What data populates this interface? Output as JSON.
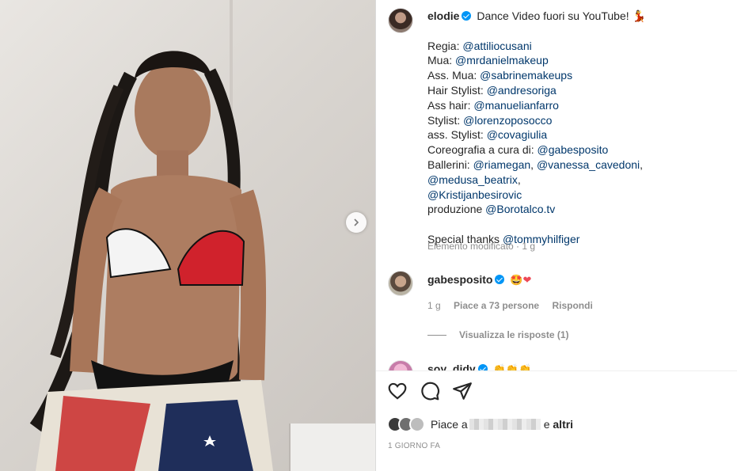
{
  "post": {
    "username": "elodie",
    "title": "Dance Video fuori su YouTube! 💃",
    "credits": [
      {
        "label": "Regia: ",
        "handle": "@attiliocusani"
      },
      {
        "label": "Mua: ",
        "handle": "@mrdanielmakeup"
      },
      {
        "label": "Ass. Mua: ",
        "handle": "@sabrinemakeups"
      },
      {
        "label": "Hair Stylist: ",
        "handle": "@andresoriga"
      },
      {
        "label": "Ass hair: ",
        "handle": "@manuelianfarro"
      },
      {
        "label": "Stylist: ",
        "handle": "@lorenzoposocco"
      },
      {
        "label": "ass. Stylist: ",
        "handle": "@covagiulia"
      },
      {
        "label": "Coreografia a cura di: ",
        "handle": "@gabesposito"
      }
    ],
    "ballerini_label": "Ballerini: ",
    "ballerini_handles": [
      "@riamegan",
      "@vanessa_cavedoni",
      "@medusa_beatrix",
      "@Kristijanbesirovic"
    ],
    "produzione_label": "produzione ",
    "produzione_handle": "@Borotalco.tv",
    "thanks_label": "Special thanks ",
    "thanks_handle": "@tommyhilfiger",
    "meta": "Elemento modificato · 1 g"
  },
  "comment": {
    "username": "gabesposito",
    "emoji": "🤩",
    "heart": "❤",
    "time": "1 g",
    "likes": "Piace a 73 persone",
    "reply": "Rispondi",
    "view_replies": "Visualizza le risposte (1)"
  },
  "next_comment": {
    "username_partial": "soy_didy",
    "emoji": "👏👏👏"
  },
  "actions": {
    "like_icon": "heart-outline",
    "comment_icon": "speech-bubble",
    "share_icon": "paper-plane"
  },
  "likes_summary": {
    "prefix": "Piace a",
    "middle": "e",
    "suffix": "altri"
  },
  "timestamp": "1 GIORNO FA",
  "colors": {
    "link": "#00376b",
    "verified": "#0095f6",
    "muted": "#8e8e8e",
    "heart": "#ed4956"
  }
}
